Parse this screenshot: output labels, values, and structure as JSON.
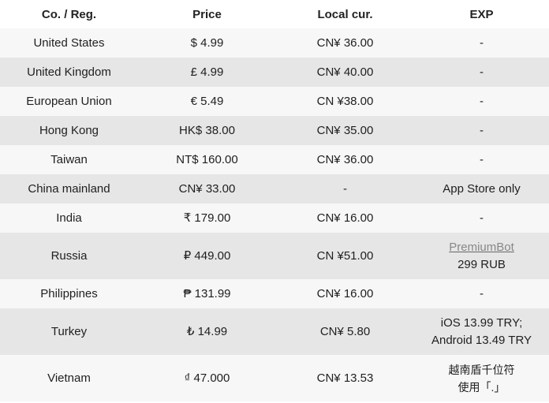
{
  "headers": [
    "Co. / Reg.",
    "Price",
    "Local cur.",
    "EXP"
  ],
  "rows": [
    {
      "region": "United States",
      "price": "$ 4.99",
      "local": "CN¥ 36.00",
      "exp": "-"
    },
    {
      "region": "United Kingdom",
      "price": "£ 4.99",
      "local": "CN¥ 40.00",
      "exp": "-"
    },
    {
      "region": "European Union",
      "price": "€ 5.49",
      "local": "CN ¥38.00",
      "exp": "-"
    },
    {
      "region": "Hong Kong",
      "price": "HK$ 38.00",
      "local": "CN¥ 35.00",
      "exp": "-"
    },
    {
      "region": "Taiwan",
      "price": "NT$ 160.00",
      "local": "CN¥ 36.00",
      "exp": "-"
    },
    {
      "region": "China mainland",
      "price": "CN¥ 33.00",
      "local": "-",
      "exp": "App Store only"
    },
    {
      "region": "India",
      "price": "₹ 179.00",
      "local": "CN¥ 16.00",
      "exp": "-"
    },
    {
      "region": "Russia",
      "price": "₽ 449.00",
      "local": "CN ¥51.00",
      "exp_link": "PremiumBot",
      "exp_line2": "299 RUB"
    },
    {
      "region": "Philippines",
      "price": "₱ 131.99",
      "local": "CN¥ 16.00",
      "exp": "-"
    },
    {
      "region": "Turkey",
      "price": "₺ 14.99",
      "local": "CN¥ 5.80",
      "exp_line1": "iOS 13.99 TRY;",
      "exp_line2": "Android 13.49 TRY"
    },
    {
      "region": "Vietnam",
      "price": "₫ 47.000",
      "local": "CN¥ 13.53",
      "exp_line1": "越南盾千位符",
      "exp_line2": "使用「.」"
    }
  ]
}
